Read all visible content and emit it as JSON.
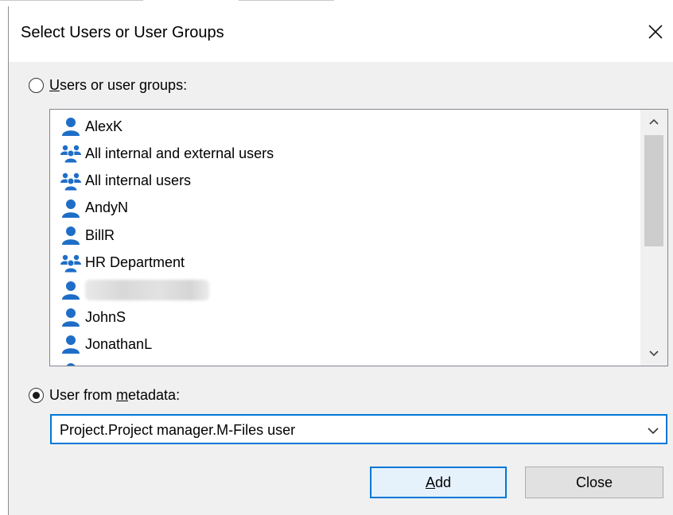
{
  "dialog": {
    "title": "Select Users or User Groups"
  },
  "users_option": {
    "label_prefix": "",
    "label_accel": "U",
    "label_rest": "sers or user groups:",
    "selected": false
  },
  "list": {
    "items": [
      {
        "icon": "user-icon",
        "label": "AlexK"
      },
      {
        "icon": "user-group-icon",
        "label": "All internal and external users"
      },
      {
        "icon": "user-group-icon",
        "label": "All internal users"
      },
      {
        "icon": "user-icon",
        "label": "AndyN"
      },
      {
        "icon": "user-icon",
        "label": "BillR"
      },
      {
        "icon": "user-group-icon",
        "label": "HR Department"
      },
      {
        "icon": "user-icon",
        "label": ""
      },
      {
        "icon": "user-icon",
        "label": "JohnS"
      },
      {
        "icon": "user-icon",
        "label": "JonathanL"
      }
    ]
  },
  "metadata_option": {
    "label_prefix": "User from ",
    "label_accel": "m",
    "label_rest": "etadata:",
    "selected": true
  },
  "metadata_combo": {
    "value": "Project.Project manager.M-Files user"
  },
  "buttons": {
    "add_accel": "A",
    "add_rest": "dd",
    "close": "Close"
  },
  "colors": {
    "accent": "#0078d7",
    "icon_blue": "#1e6ec8"
  }
}
